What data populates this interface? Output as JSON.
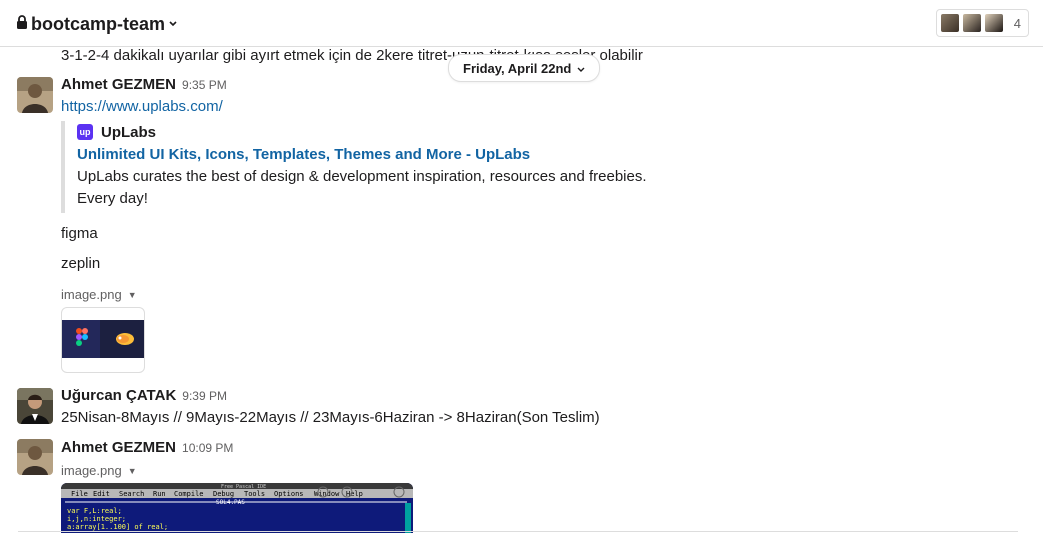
{
  "header": {
    "channel_name": "bootcamp-team",
    "member_count": "4"
  },
  "messages": {
    "partial_text": "3-1-2-4 dakikalı uyarılar gibi ayırt etmek için de 2kere titret-uzun-titret-kısa sesler olabilir",
    "date_divider": "Friday, April 22nd",
    "msg1": {
      "sender": "Ahmet GEZMEN",
      "time": "9:35 PM",
      "link": "https://www.uplabs.com/",
      "unfurl": {
        "site_icon_text": "up",
        "site_name": "UpLabs",
        "title": "Unlimited UI Kits, Icons, Templates, Themes and More - UpLabs",
        "description": "UpLabs curates the best of design & development inspiration, resources and freebies. Every day!"
      }
    },
    "msg2": {
      "text": "figma"
    },
    "msg3": {
      "text": "zeplin"
    },
    "msg4": {
      "file_name": "image.png"
    },
    "msg5": {
      "sender": "Uğurcan ÇATAK",
      "time": "9:39 PM",
      "text": "25Nisan-8Mayıs // 9Mayıs-22Mayıs // 23Mayıs-6Haziran -> 8Haziran(Son Teslim)"
    },
    "msg6": {
      "sender": "Ahmet GEZMEN",
      "time": "10:09 PM",
      "file_name": "image.png",
      "screenshot": {
        "title_bar": "Free Pascal IDE",
        "menu": [
          "File",
          "Edit",
          "Search",
          "Run",
          "Compile",
          "Debug",
          "Tools",
          "Options",
          "Window",
          "Help"
        ],
        "window_title": "SOL4.PAS",
        "code_lines": [
          "var F,L:real;",
          "    i,j,n:integer;",
          "    a:array[1..100] of real;"
        ]
      }
    }
  },
  "colors": {
    "link": "#1264a3",
    "uplabs": "#5b32f2",
    "pascal_bg": "#1a1f6e"
  }
}
